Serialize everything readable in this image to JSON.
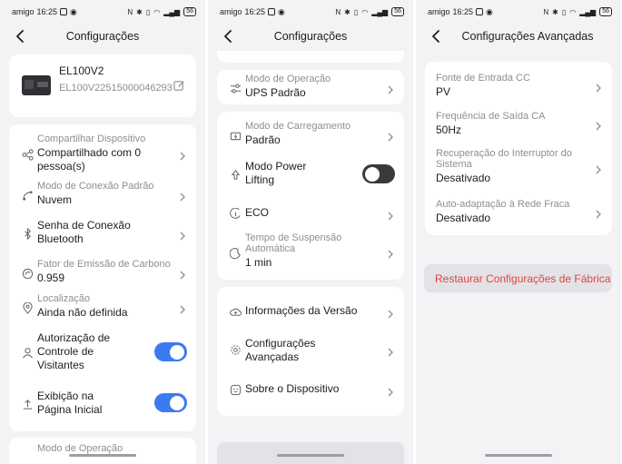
{
  "status_bar": {
    "carrier": "amigo",
    "time": "16:25",
    "battery": "56"
  },
  "panel1": {
    "title": "Configurações",
    "device": {
      "name": "EL100V2",
      "serial": "EL100V22515000046293"
    },
    "rows": {
      "share": {
        "label": "Compartilhar Dispositivo",
        "value": "Compartilhado com 0 pessoa(s)"
      },
      "connection_mode": {
        "label": "Modo de Conexão Padrão",
        "value": "Nuvem"
      },
      "bt_password": {
        "label": "Senha de Conexão Bluetooth"
      },
      "carbon": {
        "label": "Fator de Emissão de Carbono",
        "value": "0.959"
      },
      "location": {
        "label": "Localização",
        "value": "Ainda não definida"
      },
      "visitor_auth": {
        "label": "Autorização de Controle de Visitantes"
      },
      "home_display": {
        "label": "Exibição na Página Inicial"
      },
      "operation_mode_partial": {
        "label": "Modo de Operação"
      }
    }
  },
  "panel2": {
    "title": "Configurações",
    "rows": {
      "operation_mode": {
        "label": "Modo de Operação",
        "value": "UPS Padrão"
      },
      "charging_mode": {
        "label": "Modo de Carregamento",
        "value": "Padrão"
      },
      "power_lifting": {
        "label": "Modo Power Lifting"
      },
      "eco": {
        "label": "ECO"
      },
      "sleep_time": {
        "label": "Tempo de Suspensão Automática",
        "value": "1 min"
      },
      "version_info": {
        "label": "Informações da Versão"
      },
      "advanced": {
        "label": "Configurações Avançadas"
      },
      "about": {
        "label": "Sobre o Dispositivo"
      }
    }
  },
  "panel3": {
    "title": "Configurações Avançadas",
    "rows": {
      "dc_input": {
        "label": "Fonte de Entrada CC",
        "value": "PV"
      },
      "ac_freq": {
        "label": "Frequência de Saída CA",
        "value": "50Hz"
      },
      "breaker": {
        "label": "Recuperação do Interruptor do Sistema",
        "value": "Desativado"
      },
      "weak_grid": {
        "label": "Auto-adaptação à Rede Fraca",
        "value": "Desativado"
      }
    },
    "reset_label": "Restaurar Configurações de Fábrica"
  },
  "toggles": {
    "visitor_auth": true,
    "home_display": true,
    "power_lifting": false
  },
  "colors": {
    "accent": "#3a7bf0",
    "danger": "#e1463b",
    "background": "#f3f3f6",
    "card": "#ffffff"
  }
}
